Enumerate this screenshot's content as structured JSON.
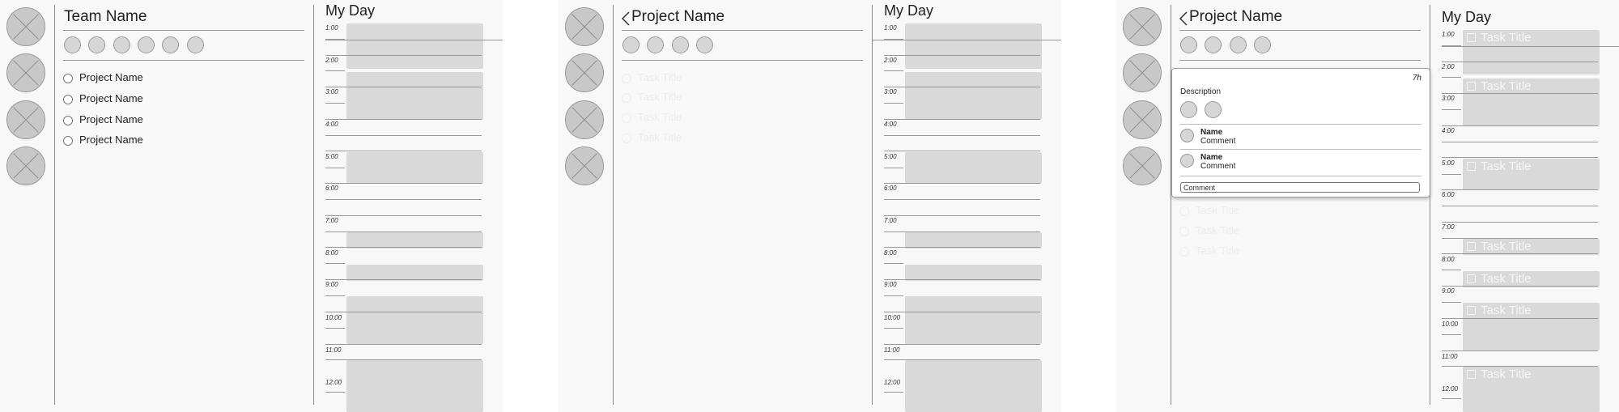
{
  "screens": [
    {
      "team_avatars": [
        1,
        2,
        3,
        4
      ],
      "title": "Team Name",
      "members": [
        1,
        2,
        3,
        4,
        5,
        6
      ],
      "projects": [
        {
          "label": "Project Name"
        },
        {
          "label": "Project Name"
        },
        {
          "label": "Project Name"
        },
        {
          "label": "Project Name"
        }
      ],
      "day_title": "My Day",
      "hours": [
        "1:00",
        "2:00",
        "3:00",
        "4:00",
        "5:00",
        "6:00",
        "7:00",
        "8:00",
        "9:00",
        "10:00",
        "11:00",
        "12:00"
      ]
    },
    {
      "team_avatars": [
        1,
        2,
        3,
        4
      ],
      "title": "Project Name",
      "members": [
        1,
        2,
        3,
        4
      ],
      "tasks": [
        {
          "label": "Task Title"
        },
        {
          "label": "Task Title"
        },
        {
          "label": "Task Title"
        },
        {
          "label": "Task Title"
        }
      ],
      "day_title": "My Day",
      "hours": [
        "1:00",
        "2:00",
        "3:00",
        "4:00",
        "5:00",
        "6:00",
        "7:00",
        "8:00",
        "9:00",
        "10:00",
        "11:00",
        "12:00"
      ]
    },
    {
      "team_avatars": [
        1,
        2,
        3,
        4
      ],
      "title": "Project Name",
      "members": [
        1,
        2,
        3,
        4
      ],
      "tasks_below": [
        {
          "label": "Task Title"
        },
        {
          "label": "Task Title"
        },
        {
          "label": "Task Title"
        }
      ],
      "card": {
        "estimate": "7h",
        "description": "Description",
        "assignees": [
          1,
          2
        ],
        "comments": [
          {
            "name": "Name",
            "text": "Comment"
          },
          {
            "name": "Name",
            "text": "Comment"
          }
        ],
        "comment_placeholder": "Comment"
      },
      "day_title": "My Day",
      "hours": [
        "1:00",
        "2:00",
        "3:00",
        "4:00",
        "5:00",
        "6:00",
        "7:00",
        "8:00",
        "9:00",
        "10:00",
        "11:00",
        "12:00"
      ],
      "schedule_tasks": [
        {
          "label": "Task Title"
        },
        {
          "label": "Task Title"
        },
        {
          "label": "Task Title"
        },
        {
          "label": "Task Title"
        },
        {
          "label": "Task Title"
        },
        {
          "label": "Task Title"
        },
        {
          "label": "Task Title"
        }
      ]
    }
  ]
}
